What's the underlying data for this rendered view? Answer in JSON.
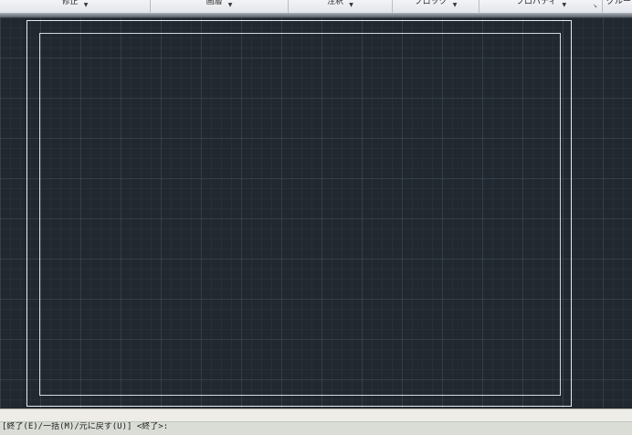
{
  "ribbon": {
    "panels": [
      {
        "label": "修正"
      },
      {
        "label": "画層"
      },
      {
        "label": "注釈"
      },
      {
        "label": "ブロック"
      },
      {
        "label": "プロパティ"
      },
      {
        "label": "グループ"
      }
    ]
  },
  "command": {
    "prompt": "[終了(E)/一括(M)/元に戻す(U)] <終了>:"
  },
  "colors": {
    "canvas_background": "#212830",
    "frame_lines": "#e8ecf0"
  },
  "icons": {
    "panel_dropdown": "triangle-down",
    "panel_launcher": "corner-arrow"
  }
}
